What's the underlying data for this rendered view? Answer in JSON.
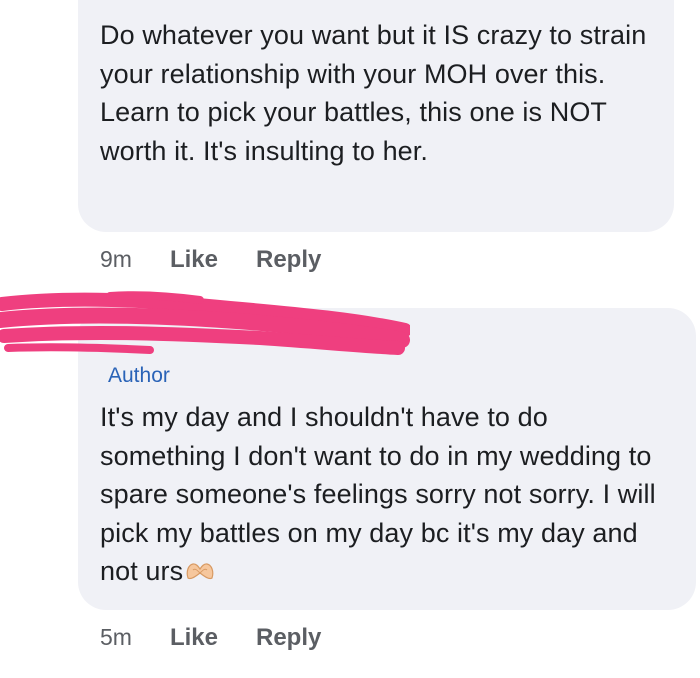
{
  "comments": [
    {
      "text": "Do whatever you want but it IS crazy to strain your relationship with your MOH over this. Learn to pick your battles, this one is NOT worth it. It's insulting to her.",
      "time": "9m",
      "like_label": "Like",
      "reply_label": "Reply"
    },
    {
      "badge": "Author",
      "text": "It's my day and I shouldn't have to do something I don't want to do in my wedding to spare someone's feelings sorry not sorry. I will pick my battles on my day bc it's my day and not urs",
      "emoji": "heart-hands-emoji",
      "time": "5m",
      "like_label": "Like",
      "reply_label": "Reply"
    }
  ],
  "redaction_color": "#ef3f7f"
}
